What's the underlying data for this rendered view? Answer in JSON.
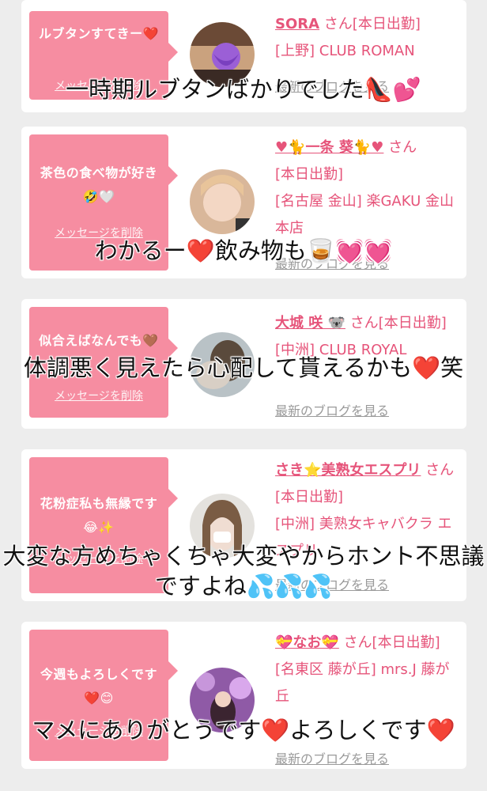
{
  "colors": {
    "accent": "#e6547a",
    "bubble": "#f68da1",
    "background": "#ededed"
  },
  "cards": [
    {
      "bubble": "ルブタンすてきー❤️",
      "delete_label": "メッセージを削除",
      "name": "SORA",
      "info": "さん[本日出勤]\n[上野] CLUB ROMAN",
      "blog": "最新のブログを見る",
      "caption": "一時期ルブタンばかりでした👠💕"
    },
    {
      "bubble": "茶色の食べ物が好き🤣🤍",
      "delete_label": "メッセージを削除",
      "name": "♥🐈一条 葵🐈♥",
      "info": "さん\n[本日出勤]\n[名古屋 金山] 楽GAKU 金山本店",
      "blog": "最新のブログを見る",
      "caption": "わかるー❤️飲み物も🥃💓💓"
    },
    {
      "bubble": "似合えばなんでも🤎",
      "delete_label": "メッセージを削除",
      "name": "大城 咲 🐨",
      "info": "さん[本日出勤]\n[中洲] CLUB ROYAL",
      "blog": "最新のブログを見る",
      "caption": "体調悪く見えたら心配して貰えるかも❤️笑"
    },
    {
      "bubble": "花粉症私も無縁です😂✨",
      "delete_label": "メッセージを削除",
      "name": "さき⭐美熟女エスプリ",
      "info": "さん[本日出勤]\n[中洲] 美熟女キャバクラ エスプリ",
      "blog": "最新のブログを見る",
      "caption": "大変な方めちゃくちゃ大変やからホント不思議ですよね💦💦💦"
    },
    {
      "bubble": "今週もよろしくです❤️😊",
      "delete_label": "メッセージを削除",
      "name": "💝なお💝",
      "info": "さん[本日出勤]\n[名東区 藤が丘] mrs.J 藤が丘",
      "blog": "最新のブログを見る",
      "caption": "マメにありがとうです❤️よろしくです❤️"
    }
  ]
}
